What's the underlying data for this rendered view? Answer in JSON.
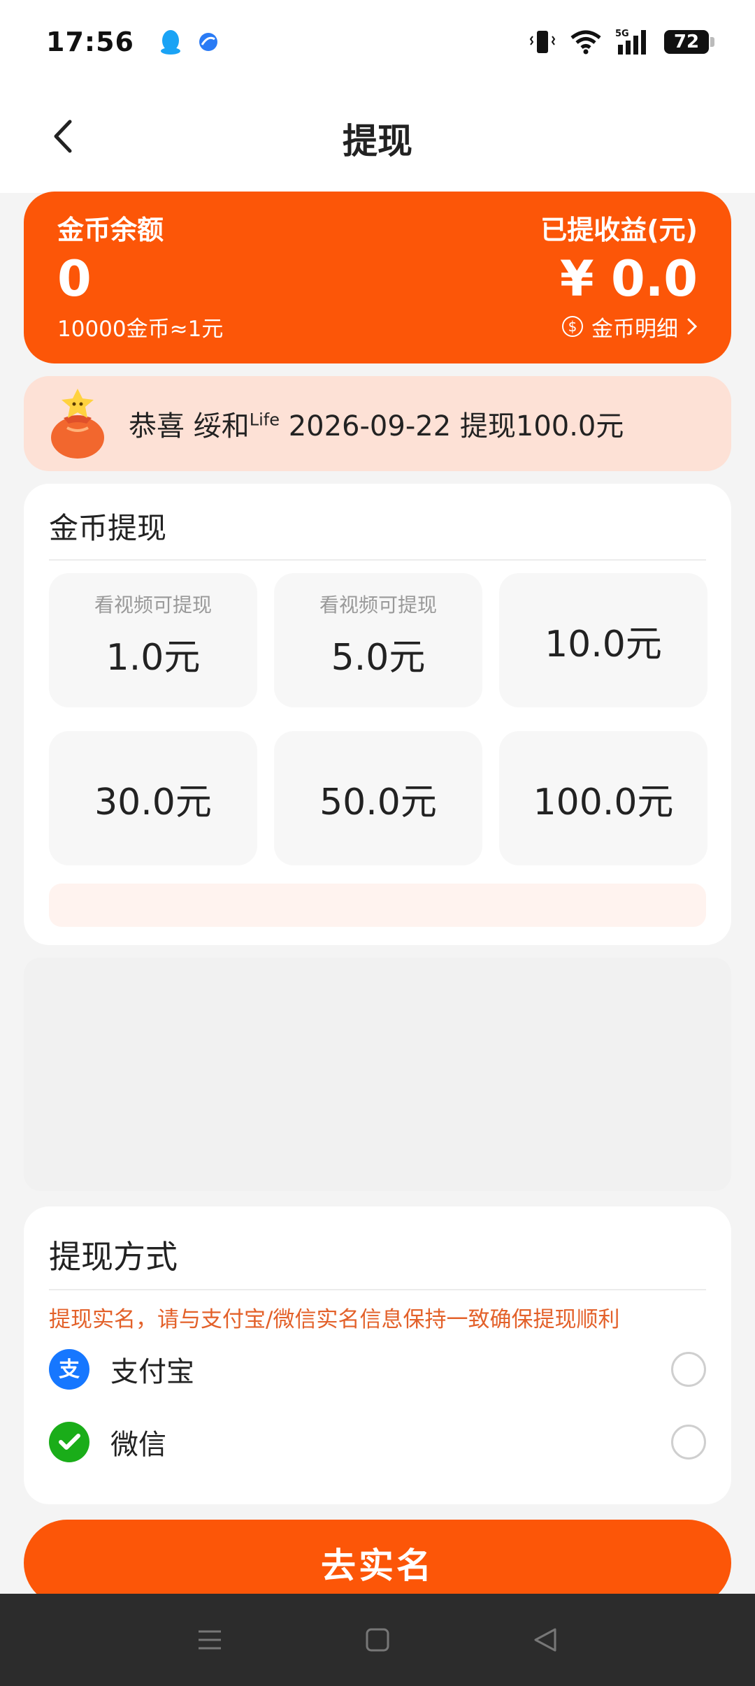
{
  "status_bar": {
    "time": "17:56",
    "battery": "72"
  },
  "header": {
    "title": "提现"
  },
  "balance": {
    "coin_label": "金币余额",
    "coin_value": "0",
    "rate": "10000金币≈1元",
    "earned_label": "已提收益(元)",
    "earned_value": "¥ 0.0",
    "detail_link": "金币明细"
  },
  "notice": {
    "prefix": "恭喜 绥和",
    "sup": "Life",
    "suffix": " 2026-09-22 提现100.0元"
  },
  "withdraw": {
    "title": "金币提现",
    "options": [
      {
        "hint": "看视频可提现",
        "amount": "1.0元"
      },
      {
        "hint": "看视频可提现",
        "amount": "5.0元"
      },
      {
        "hint": "",
        "amount": "10.0元"
      },
      {
        "hint": "",
        "amount": "30.0元"
      },
      {
        "hint": "",
        "amount": "50.0元"
      },
      {
        "hint": "",
        "amount": "100.0元"
      }
    ]
  },
  "method": {
    "title": "提现方式",
    "tip": "提现实名，请与支付宝/微信实名信息保持一致确保提现顺利",
    "options": [
      {
        "label": "支付宝",
        "icon": "alipay-icon",
        "color": "#1677ff"
      },
      {
        "label": "微信",
        "icon": "wechat-icon",
        "color": "#1aad19"
      }
    ]
  },
  "submit": {
    "label": "去实名"
  },
  "colors": {
    "accent": "#fc5608",
    "notice_bg": "#fde1d6",
    "tip": "#e3612a"
  }
}
